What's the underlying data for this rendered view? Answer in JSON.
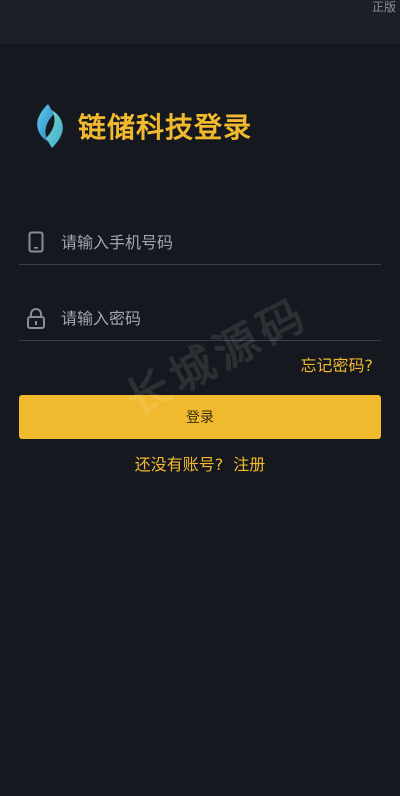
{
  "status_bar": {
    "text": "正版"
  },
  "brand": {
    "title": "链储科技登录",
    "logo_icon": "brand-logo-icon"
  },
  "form": {
    "phone": {
      "placeholder": "请输入手机号码",
      "value": "",
      "icon": "phone-icon"
    },
    "password": {
      "placeholder": "请输入密码",
      "value": "",
      "icon": "lock-icon"
    },
    "forgot_label": "忘记密码?",
    "login_label": "登录",
    "no_account_label": "还没有账号?",
    "register_label": "注册"
  },
  "watermark": {
    "text": "长城源码"
  },
  "colors": {
    "accent": "#f1b92d",
    "background": "#16181f",
    "status_bar": "#1d2028",
    "divider": "#3b3f4a"
  }
}
